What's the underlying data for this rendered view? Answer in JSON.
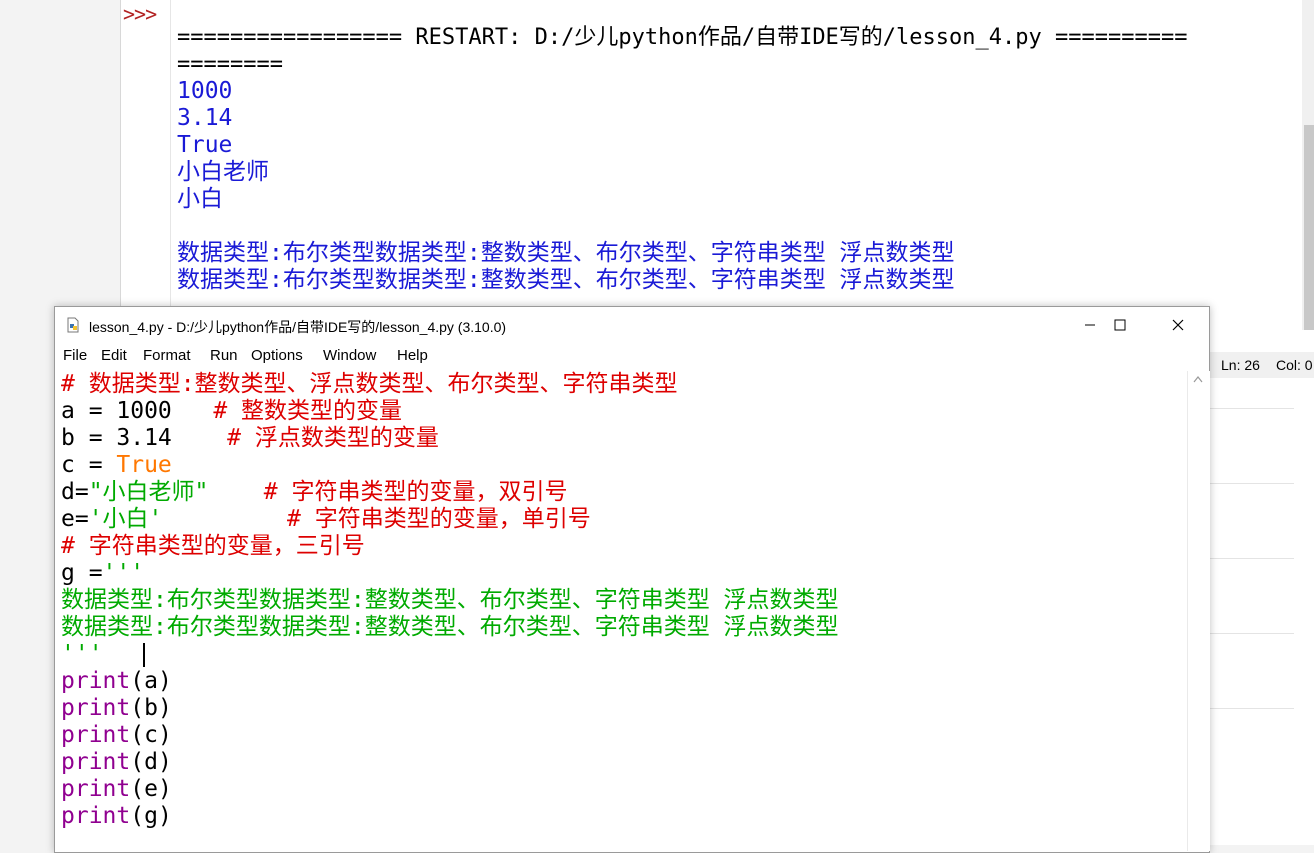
{
  "shell": {
    "prompt": ">>>",
    "restart_line1": "================= RESTART: D:/少儿python作品/自带IDE写的/lesson_4.py ==========",
    "restart_line2": "========",
    "outputs": [
      "1000",
      "3.14",
      "True",
      "小白老师",
      "小白",
      "",
      "数据类型:布尔类型数据类型:整数类型、布尔类型、字符串类型 浮点数类型",
      "数据类型:布尔类型数据类型:整数类型、布尔类型、字符串类型 浮点数类型"
    ],
    "status_ln": "Ln: 26",
    "status_col": "Col: 0"
  },
  "editor_window": {
    "title": "lesson_4.py - D:/少儿python作品/自带IDE写的/lesson_4.py (3.10.0)",
    "icons": {
      "app": "python-file-icon",
      "minimize": "minimize-icon",
      "maximize": "maximize-icon",
      "close": "close-icon"
    },
    "menu": [
      "File",
      "Edit",
      "Format",
      "Run",
      "Options",
      "Window",
      "Help"
    ]
  },
  "code": {
    "l1": "# 数据类型:整数类型、浮点数类型、布尔类型、字符串类型",
    "l2a": "a = 1000   ",
    "l2b": "# 整数类型的变量",
    "l3a": "b = 3.14    ",
    "l3b": "# 浮点数类型的变量",
    "l4a": "c = ",
    "l4b": "True",
    "l5a": "d=",
    "l5b": "\"小白老师\"",
    "l5c": "    # 字符串类型的变量，双引号",
    "l6a": "e=",
    "l6b": "'小白'",
    "l6c": "         # 字符串类型的变量，单引号",
    "l7": "# 字符串类型的变量，三引号",
    "l8a": "g =",
    "l8b": "'''",
    "l9": "数据类型:布尔类型数据类型:整数类型、布尔类型、字符串类型 浮点数类型",
    "l10": "数据类型:布尔类型数据类型:整数类型、布尔类型、字符串类型 浮点数类型",
    "l11": "'''",
    "print_kw": "print",
    "args": [
      "(a)",
      "(b)",
      "(c)",
      "(d)",
      "(e)",
      "(g)"
    ]
  },
  "colors": {
    "comment": "#dd0000",
    "string": "#00aa00",
    "keyword": "#ff7700",
    "builtin": "#900090",
    "output": "#1a1ad6"
  }
}
